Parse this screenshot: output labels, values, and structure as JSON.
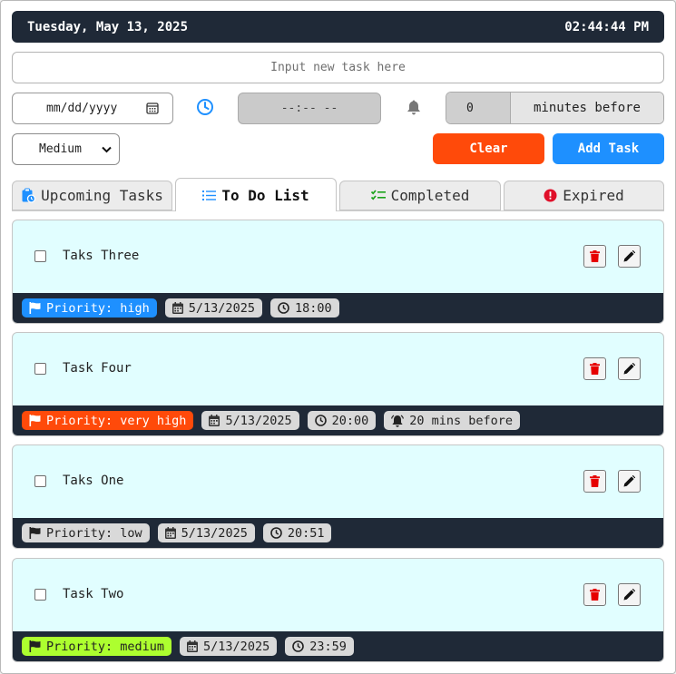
{
  "header": {
    "date": "Tuesday, May 13, 2025",
    "time": "02:44:44 PM"
  },
  "form": {
    "task_placeholder": "Input new task here",
    "date_placeholder": "mm/dd/yyyy",
    "time_placeholder": "--:-- --",
    "remind_value": "0",
    "remind_label": "minutes before",
    "priority_selected": "Medium",
    "clear_label": "Clear",
    "add_label": "Add Task"
  },
  "tabs": [
    {
      "label": "Upcoming Tasks",
      "icon": "clipboard-clock-icon"
    },
    {
      "label": "To Do List",
      "icon": "list-icon",
      "active": true
    },
    {
      "label": "Completed",
      "icon": "checklist-icon"
    },
    {
      "label": "Expired",
      "icon": "alert-circle-icon"
    }
  ],
  "tasks": [
    {
      "title": "Taks Three",
      "priority": "Priority: high",
      "priority_color": "#1e90ff",
      "date": "5/13/2025",
      "time": "18:00",
      "reminder": ""
    },
    {
      "title": "Task Four",
      "priority": "Priority: very high",
      "priority_color": "#ff4a0a",
      "date": "5/13/2025",
      "time": "20:00",
      "reminder": "20 mins before"
    },
    {
      "title": "Taks One",
      "priority": "Priority: low",
      "priority_color": "#d9d9d9",
      "date": "5/13/2025",
      "time": "20:51",
      "reminder": ""
    },
    {
      "title": "Task Two",
      "priority": "Priority: medium",
      "priority_color": "#adff2f",
      "date": "5/13/2025",
      "time": "23:59",
      "reminder": ""
    }
  ],
  "colors": {
    "header_bg": "#1f2937",
    "card_bg": "#e1feff",
    "clear": "#ff4a0a",
    "add": "#1e90ff",
    "delete": "#e60000"
  }
}
